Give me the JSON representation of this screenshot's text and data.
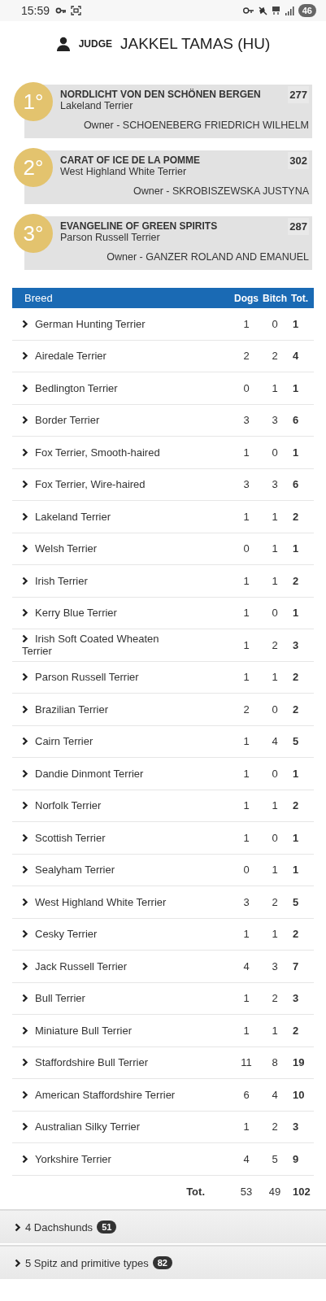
{
  "status_bar": {
    "time": "15:59",
    "battery": "46"
  },
  "judge": {
    "label": "JUDGE",
    "name": "JAKKEL TAMAS (HU)"
  },
  "winners": [
    {
      "place": "1°",
      "dog": "NORDLICHT VON DEN SCHÖNEN BERGEN",
      "breed": "Lakeland Terrier",
      "number": "277",
      "owner": "Owner - SCHOENEBERG FRIEDRICH WILHELM"
    },
    {
      "place": "2°",
      "dog": "CARAT OF ICE DE LA POMME",
      "breed": "West Highland White Terrier",
      "number": "302",
      "owner": "Owner - SKROBISZEWSKA JUSTYNA"
    },
    {
      "place": "3°",
      "dog": "EVANGELINE OF GREEN SPIRITS",
      "breed": "Parson Russell Terrier",
      "number": "287",
      "owner": "Owner - GANZER ROLAND AND EMANUEL"
    }
  ],
  "table": {
    "columns": [
      "Breed",
      "Dogs",
      "Bitch",
      "Tot."
    ],
    "rows": [
      [
        "German Hunting Terrier",
        "1",
        "0",
        "1"
      ],
      [
        "Airedale Terrier",
        "2",
        "2",
        "4"
      ],
      [
        "Bedlington Terrier",
        "0",
        "1",
        "1"
      ],
      [
        "Border Terrier",
        "3",
        "3",
        "6"
      ],
      [
        "Fox Terrier, Smooth-haired",
        "1",
        "0",
        "1"
      ],
      [
        "Fox Terrier, Wire-haired",
        "3",
        "3",
        "6"
      ],
      [
        "Lakeland Terrier",
        "1",
        "1",
        "2"
      ],
      [
        "Welsh Terrier",
        "0",
        "1",
        "1"
      ],
      [
        "Irish Terrier",
        "1",
        "1",
        "2"
      ],
      [
        "Kerry Blue Terrier",
        "1",
        "0",
        "1"
      ],
      [
        "Irish Soft Coated Wheaten Terrier",
        "1",
        "2",
        "3"
      ],
      [
        "Parson Russell Terrier",
        "1",
        "1",
        "2"
      ],
      [
        "Brazilian Terrier",
        "2",
        "0",
        "2"
      ],
      [
        "Cairn Terrier",
        "1",
        "4",
        "5"
      ],
      [
        "Dandie Dinmont Terrier",
        "1",
        "0",
        "1"
      ],
      [
        "Norfolk Terrier",
        "1",
        "1",
        "2"
      ],
      [
        "Scottish Terrier",
        "1",
        "0",
        "1"
      ],
      [
        "Sealyham Terrier",
        "0",
        "1",
        "1"
      ],
      [
        "West Highland White Terrier",
        "3",
        "2",
        "5"
      ],
      [
        "Cesky Terrier",
        "1",
        "1",
        "2"
      ],
      [
        "Jack Russell Terrier",
        "4",
        "3",
        "7"
      ],
      [
        "Bull Terrier",
        "1",
        "2",
        "3"
      ],
      [
        "Miniature Bull Terrier",
        "1",
        "1",
        "2"
      ],
      [
        "Staffordshire Bull Terrier",
        "11",
        "8",
        "19"
      ],
      [
        "American Staffordshire Terrier",
        "6",
        "4",
        "10"
      ],
      [
        "Australian Silky Terrier",
        "1",
        "2",
        "3"
      ],
      [
        "Yorkshire Terrier",
        "4",
        "5",
        "9"
      ]
    ],
    "total": {
      "label": "Tot.",
      "dogs": "53",
      "bitches": "49",
      "total": "102"
    }
  },
  "groups": [
    {
      "title": "4 Dachshunds",
      "count": "51"
    },
    {
      "title": "5 Spitz and primitive types",
      "count": "82"
    }
  ]
}
